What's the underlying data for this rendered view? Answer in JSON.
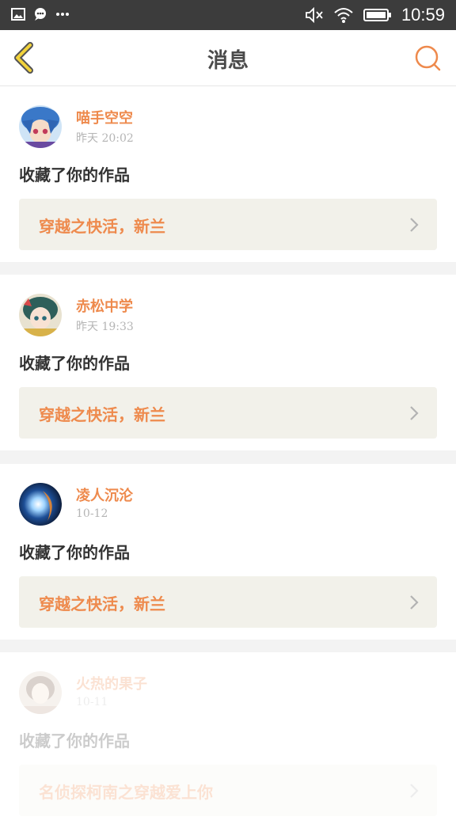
{
  "status_bar": {
    "time": "10:59"
  },
  "header": {
    "title": "消息"
  },
  "messages": [
    {
      "user": "喵手空空",
      "time": "昨天 20:02",
      "action": "收藏了你的作品",
      "work": "穿越之快活，新兰"
    },
    {
      "user": "赤松中学",
      "time": "昨天 19:33",
      "action": "收藏了你的作品",
      "work": "穿越之快活，新兰"
    },
    {
      "user": "凌人沉沦",
      "time": "10-12",
      "action": "收藏了你的作品",
      "work": "穿越之快活，新兰"
    },
    {
      "user": "火热的果子",
      "time": "10-11",
      "action": "收藏了你的作品",
      "work": "名侦探柯南之穿越爱上你"
    }
  ],
  "colors": {
    "accent": "#ee8a4d",
    "back_icon": "#f2d33b",
    "status_bar": "#3c3c3c"
  }
}
